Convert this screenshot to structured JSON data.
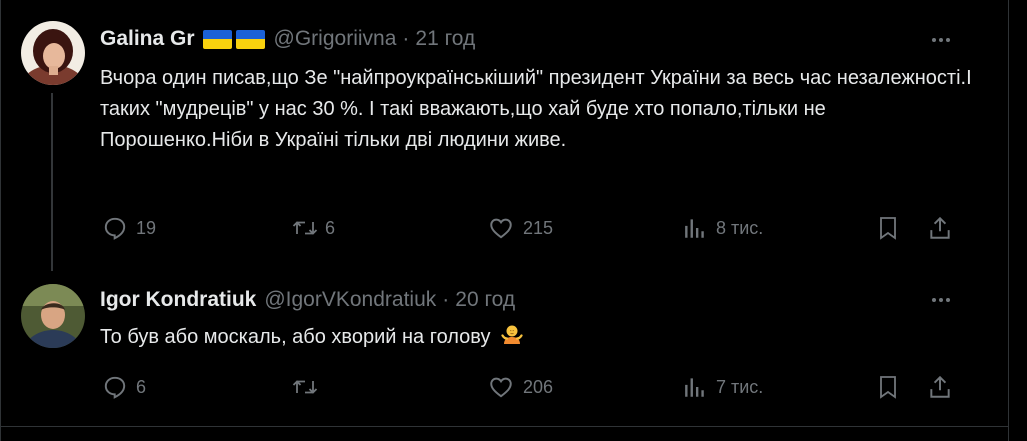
{
  "tweets": [
    {
      "name": "Galina Gr",
      "handle": "@Grigoriivna",
      "separator": "·",
      "time": "21 год",
      "text": "Вчора один писав,що Зе  \"найпроукраїнськіший\" президент України за весь час незалежності.І таких \"мудреців\"  у нас 30 %.  І такі вважають,що хай буде хто попало,тільки не Порошенко.Ніби в Україні тільки дві  людини живе.",
      "replies": "19",
      "reposts": "6",
      "likes": "215",
      "views": "8 тис."
    },
    {
      "name": "Igor Kondratiuk",
      "handle": "@IgorVKondratiuk",
      "separator": "·",
      "time": "20 год",
      "text": "То був або москаль, або хворий на голову",
      "replies": "6",
      "reposts": "",
      "likes": "206",
      "views": "7 тис."
    }
  ],
  "icons": {
    "flag": "ukraine-flag",
    "more": "more-horizontal-icon",
    "reply": "reply-icon",
    "repost": "repost-icon",
    "like": "heart-icon",
    "views": "views-chart-icon",
    "bookmark": "bookmark-icon",
    "share": "share-icon",
    "emoji": "person-shrugging-emoji"
  },
  "colors": {
    "background": "#000000",
    "text": "#e7e9ea",
    "muted": "#71767b",
    "border": "#2f3336",
    "flag_blue": "#1b61d6",
    "flag_yellow": "#f8d10e"
  }
}
